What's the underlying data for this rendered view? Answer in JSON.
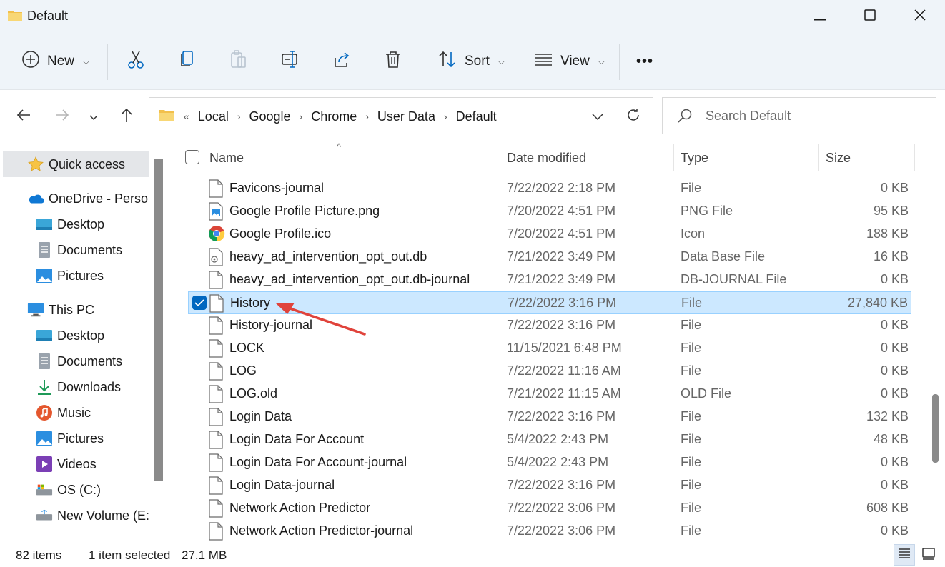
{
  "window": {
    "title": "Default",
    "minimize_icon": "minimize-icon",
    "maximize_icon": "maximize-icon",
    "close_icon": "close-icon"
  },
  "toolbar": {
    "new_label": "New",
    "sort_label": "Sort",
    "view_label": "View",
    "more_label": "•••"
  },
  "address": {
    "overflow": "«",
    "crumbs": [
      "Local",
      "Google",
      "Chrome",
      "User Data",
      "Default"
    ]
  },
  "search": {
    "placeholder": "Search Default"
  },
  "sidebar": {
    "items": [
      {
        "label": "Quick access",
        "icon": "star-icon"
      },
      {
        "label": "OneDrive - Personal",
        "icon": "onedrive-icon"
      },
      {
        "label": "Desktop",
        "icon": "desktop-icon"
      },
      {
        "label": "Documents",
        "icon": "documents-icon"
      },
      {
        "label": "Pictures",
        "icon": "pictures-icon"
      },
      {
        "label": "This PC",
        "icon": "this-pc-icon"
      },
      {
        "label": "Desktop",
        "icon": "desktop-icon"
      },
      {
        "label": "Documents",
        "icon": "documents-icon"
      },
      {
        "label": "Downloads",
        "icon": "downloads-icon"
      },
      {
        "label": "Music",
        "icon": "music-icon"
      },
      {
        "label": "Pictures",
        "icon": "pictures-icon"
      },
      {
        "label": "Videos",
        "icon": "videos-icon"
      },
      {
        "label": "OS (C:)",
        "icon": "drive-icon"
      },
      {
        "label": "New Volume (E:)",
        "icon": "network-drive-icon"
      }
    ]
  },
  "columns": {
    "name": "Name",
    "date": "Date modified",
    "type": "Type",
    "size": "Size"
  },
  "files": [
    {
      "name": "Favicons-journal",
      "date": "7/22/2022 2:18 PM",
      "type": "File",
      "size": "0 KB",
      "icon": "file-icon"
    },
    {
      "name": "Google Profile Picture.png",
      "date": "7/20/2022 4:51 PM",
      "type": "PNG File",
      "size": "95 KB",
      "icon": "image-file-icon"
    },
    {
      "name": "Google Profile.ico",
      "date": "7/20/2022 4:51 PM",
      "type": "Icon",
      "size": "188 KB",
      "icon": "chrome-icon"
    },
    {
      "name": "heavy_ad_intervention_opt_out.db",
      "date": "7/21/2022 3:49 PM",
      "type": "Data Base File",
      "size": "16 KB",
      "icon": "db-file-icon"
    },
    {
      "name": "heavy_ad_intervention_opt_out.db-journal",
      "date": "7/21/2022 3:49 PM",
      "type": "DB-JOURNAL File",
      "size": "0 KB",
      "icon": "file-icon"
    },
    {
      "name": "History",
      "date": "7/22/2022 3:16 PM",
      "type": "File",
      "size": "27,840 KB",
      "icon": "file-icon",
      "selected": true
    },
    {
      "name": "History-journal",
      "date": "7/22/2022 3:16 PM",
      "type": "File",
      "size": "0 KB",
      "icon": "file-icon"
    },
    {
      "name": "LOCK",
      "date": "11/15/2021 6:48 PM",
      "type": "File",
      "size": "0 KB",
      "icon": "file-icon"
    },
    {
      "name": "LOG",
      "date": "7/22/2022 11:16 AM",
      "type": "File",
      "size": "0 KB",
      "icon": "file-icon"
    },
    {
      "name": "LOG.old",
      "date": "7/21/2022 11:15 AM",
      "type": "OLD File",
      "size": "0 KB",
      "icon": "file-icon"
    },
    {
      "name": "Login Data",
      "date": "7/22/2022 3:16 PM",
      "type": "File",
      "size": "132 KB",
      "icon": "file-icon"
    },
    {
      "name": "Login Data For Account",
      "date": "5/4/2022 2:43 PM",
      "type": "File",
      "size": "48 KB",
      "icon": "file-icon"
    },
    {
      "name": "Login Data For Account-journal",
      "date": "5/4/2022 2:43 PM",
      "type": "File",
      "size": "0 KB",
      "icon": "file-icon"
    },
    {
      "name": "Login Data-journal",
      "date": "7/22/2022 3:16 PM",
      "type": "File",
      "size": "0 KB",
      "icon": "file-icon"
    },
    {
      "name": "Network Action Predictor",
      "date": "7/22/2022 3:06 PM",
      "type": "File",
      "size": "608 KB",
      "icon": "file-icon"
    },
    {
      "name": "Network Action Predictor-journal",
      "date": "7/22/2022 3:06 PM",
      "type": "File",
      "size": "0 KB",
      "icon": "file-icon"
    }
  ],
  "status": {
    "item_count": "82 items",
    "selection": "1 item selected",
    "selection_size": "27.1 MB"
  },
  "colors": {
    "accent": "#0067c0",
    "selection_bg": "#cce8ff",
    "annotation_arrow": "#e0433b",
    "folder": "#f2c04c"
  }
}
